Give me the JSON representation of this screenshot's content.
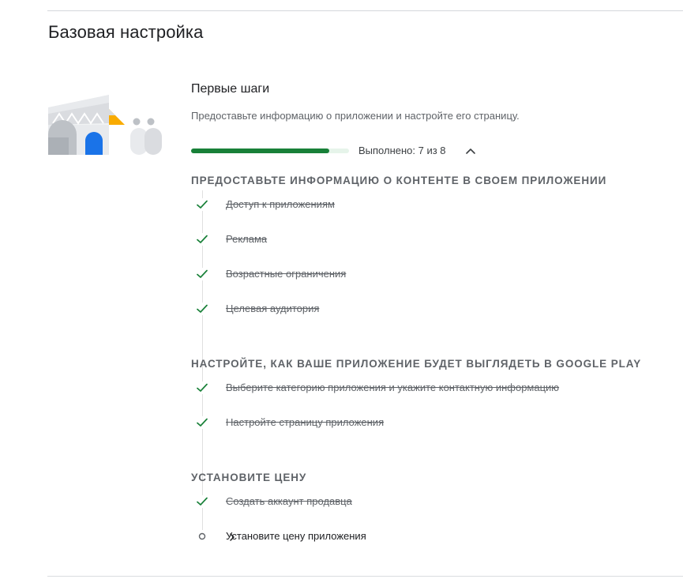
{
  "page": {
    "title": "Базовая настройка"
  },
  "setup": {
    "heading": "Первые шаги",
    "description": "Предоставьте информацию о приложении и настройте его страницу.",
    "progress_text": "Выполнено: 7 из 8",
    "progress_completed": 7,
    "progress_total": 8,
    "progress_fraction": 0.875,
    "collapse_icon": "chevron-up-icon"
  },
  "groups": [
    {
      "title": "ПРЕДОСТАВЬТЕ ИНФОРМАЦИЮ О КОНТЕНТЕ В СВОЕМ ПРИЛОЖЕНИИ",
      "steps": [
        {
          "label": "Доступ к приложениям",
          "done": true
        },
        {
          "label": "Реклама",
          "done": true
        },
        {
          "label": "Возрастные ограничения",
          "done": true
        },
        {
          "label": "Целевая аудитория",
          "done": true
        }
      ]
    },
    {
      "title": "НАСТРОЙТЕ, КАК ВАШЕ ПРИЛОЖЕНИЕ БУДЕТ ВЫГЛЯДЕТЬ В GOOGLE PLAY",
      "steps": [
        {
          "label": "Выберите категорию приложения и укажите контактную информацию",
          "done": true
        },
        {
          "label": "Настройте страницу приложения",
          "done": true
        }
      ]
    },
    {
      "title": "УСТАНОВИТЕ ЦЕНУ",
      "steps": [
        {
          "label": "Создать аккаунт продавца",
          "done": true
        },
        {
          "label": "Установите цену приложения",
          "done": false
        }
      ]
    }
  ],
  "colors": {
    "accent": "#188038",
    "progress_track": "#e6f4ea",
    "check": "#188038",
    "muted_text": "#5f6368",
    "divider": "#dadce0"
  }
}
